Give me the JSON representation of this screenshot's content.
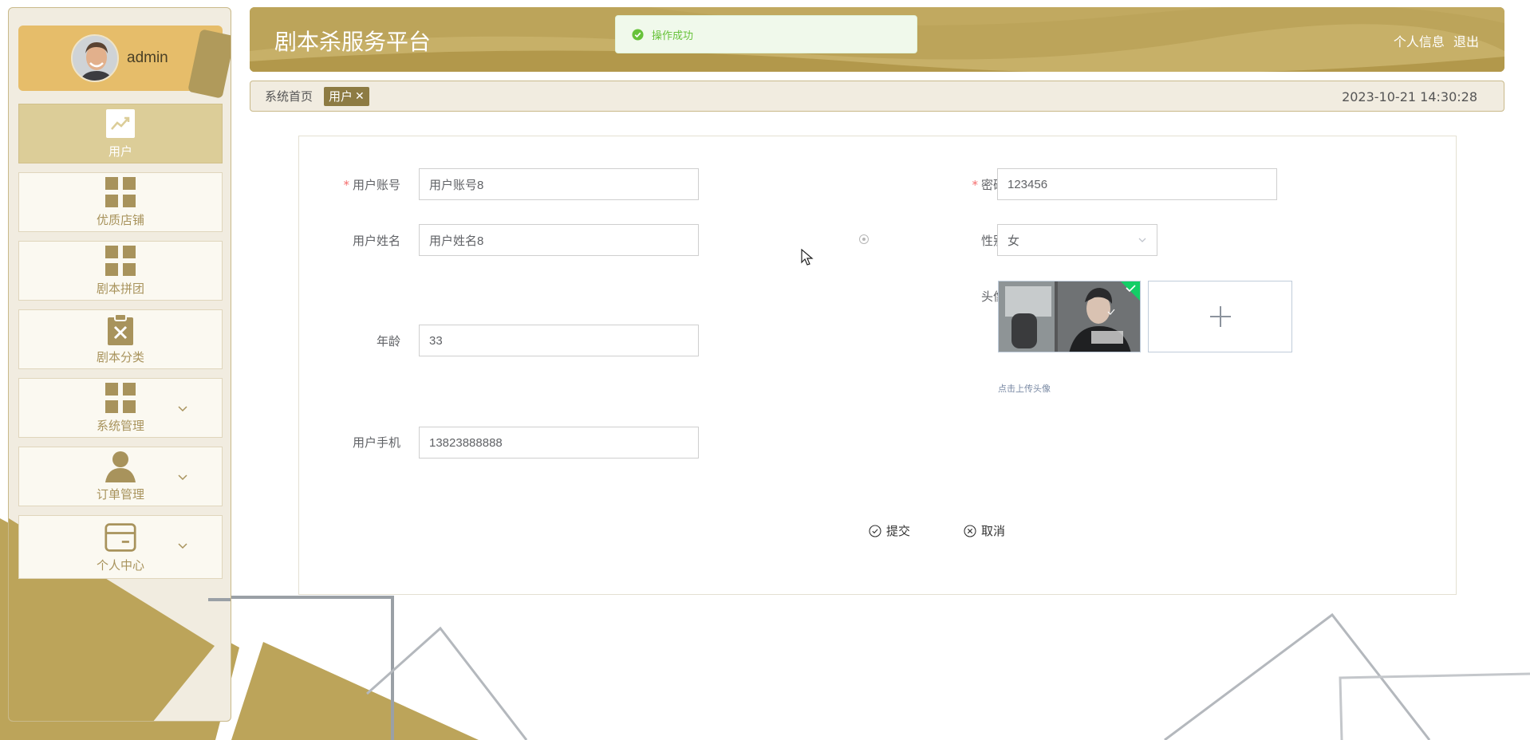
{
  "sidebar": {
    "user": {
      "name": "admin"
    },
    "items": [
      {
        "label": "用户",
        "active": true,
        "has_children": false
      },
      {
        "label": "优质店铺",
        "active": false,
        "has_children": false
      },
      {
        "label": "剧本拼团",
        "active": false,
        "has_children": false
      },
      {
        "label": "剧本分类",
        "active": false,
        "has_children": false
      },
      {
        "label": "系统管理",
        "active": false,
        "has_children": true
      },
      {
        "label": "订单管理",
        "active": false,
        "has_children": true
      },
      {
        "label": "个人中心",
        "active": false,
        "has_children": true
      }
    ]
  },
  "header": {
    "title": "剧本杀服务平台",
    "profile_link": "个人信息",
    "logout_link": "退出"
  },
  "toast": {
    "message": "操作成功"
  },
  "breadcrumb": {
    "home": "系统首页",
    "tag": "用户",
    "tag_close": "✕",
    "datetime": "2023-10-21 14:30:28"
  },
  "form": {
    "account": {
      "label": "用户账号",
      "value": "用户账号8",
      "required": true
    },
    "password": {
      "label": "密码",
      "value": "123456",
      "required": true
    },
    "name": {
      "label": "用户姓名",
      "value": "用户姓名8"
    },
    "gender": {
      "label": "性别",
      "value": "女"
    },
    "avatar": {
      "label": "头像",
      "tip": "点击上传头像"
    },
    "age": {
      "label": "年龄",
      "value": "33"
    },
    "phone": {
      "label": "用户手机",
      "value": "13823888888"
    },
    "submit_label": "提交",
    "cancel_label": "取消"
  },
  "colors": {
    "accent": "#bca45a",
    "accent_dark": "#8d7b43",
    "menu_label": "#a8935c",
    "success": "#67c23a",
    "required": "#f56c6c"
  }
}
